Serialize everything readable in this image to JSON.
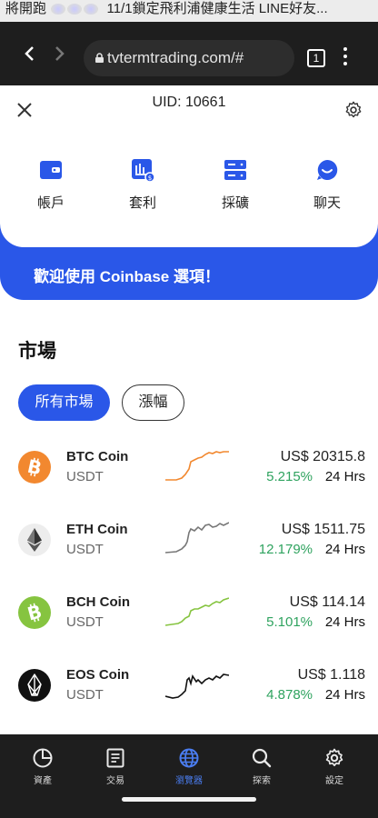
{
  "notification": {
    "prefix": "將開跑",
    "text": "11/1鎖定飛利浦健康生活 LINE好友..."
  },
  "browser": {
    "url": "tvtermtrading.com/#",
    "tab_count": "1",
    "back_icon": "chevron-left-icon",
    "forward_icon": "chevron-right-icon"
  },
  "panel": {
    "uid": "UID: 10661",
    "actions": [
      {
        "label": "帳戶",
        "icon": "wallet-icon"
      },
      {
        "label": "套利",
        "icon": "arbitrage-icon"
      },
      {
        "label": "採礦",
        "icon": "server-icon"
      },
      {
        "label": "聊天",
        "icon": "chat-icon"
      }
    ],
    "welcome": "歡迎使用 Coinbase 選項！"
  },
  "market": {
    "title": "市場",
    "filters": [
      {
        "label": "所有市場",
        "active": true
      },
      {
        "label": "漲幅",
        "active": false
      }
    ],
    "rows": [
      {
        "name": "BTC Coin",
        "quote": "USDT",
        "price": "US$ 20315.8",
        "change": "5.215%",
        "period": "24 Hrs",
        "color": "#f2882f"
      },
      {
        "name": "ETH Coin",
        "quote": "USDT",
        "price": "US$ 1511.75",
        "change": "12.179%",
        "period": "24 Hrs",
        "color": "#777777"
      },
      {
        "name": "BCH Coin",
        "quote": "USDT",
        "price": "US$ 114.14",
        "change": "5.101%",
        "period": "24 Hrs",
        "color": "#86c440"
      },
      {
        "name": "EOS Coin",
        "quote": "USDT",
        "price": "US$ 1.118",
        "change": "4.878%",
        "period": "24 Hrs",
        "color": "#111111"
      }
    ]
  },
  "bottom_nav": [
    {
      "label": "資產",
      "icon": "pie-chart-icon",
      "active": false
    },
    {
      "label": "交易",
      "icon": "document-icon",
      "active": false
    },
    {
      "label": "瀏覽器",
      "icon": "globe-icon",
      "active": true
    },
    {
      "label": "探索",
      "icon": "search-icon",
      "active": false
    },
    {
      "label": "設定",
      "icon": "gear-icon",
      "active": false
    }
  ],
  "colors": {
    "accent": "#2a57e8",
    "positive": "#2fa35f",
    "dark_bar": "#1e1e1e"
  }
}
